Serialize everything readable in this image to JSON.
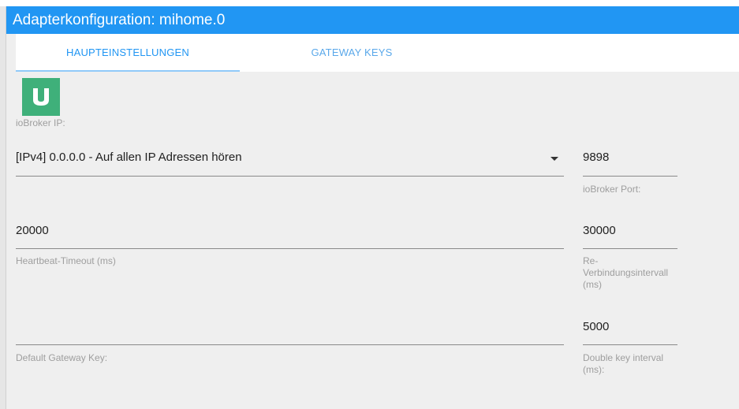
{
  "window": {
    "title": "Adapterkonfiguration: mihome.0"
  },
  "tabs": [
    {
      "label": "HAUPTEINSTELLUNGEN"
    },
    {
      "label": "GATEWAY KEYS"
    }
  ],
  "colors": {
    "accent": "#2196f3",
    "logo": "#3fb07a"
  },
  "logo": {
    "icon": "mi-logo-icon"
  },
  "fields": {
    "ip": {
      "label": "ioBroker IP:",
      "value": "[IPv4] 0.0.0.0 - Auf allen IP Adressen hören"
    },
    "port": {
      "label": "ioBroker Port:",
      "value": "9898"
    },
    "heartbeat": {
      "label": "Heartbeat-Timeout (ms)",
      "value": "20000"
    },
    "reconnect": {
      "label_lines": [
        "Re-",
        "Verbindungsintervall",
        "(ms)"
      ],
      "value": "30000"
    },
    "gateway_key": {
      "label": "Default Gateway Key:",
      "value": ""
    },
    "double_key": {
      "label_lines": [
        "Double key interval",
        "(ms):"
      ],
      "value": "5000"
    }
  }
}
